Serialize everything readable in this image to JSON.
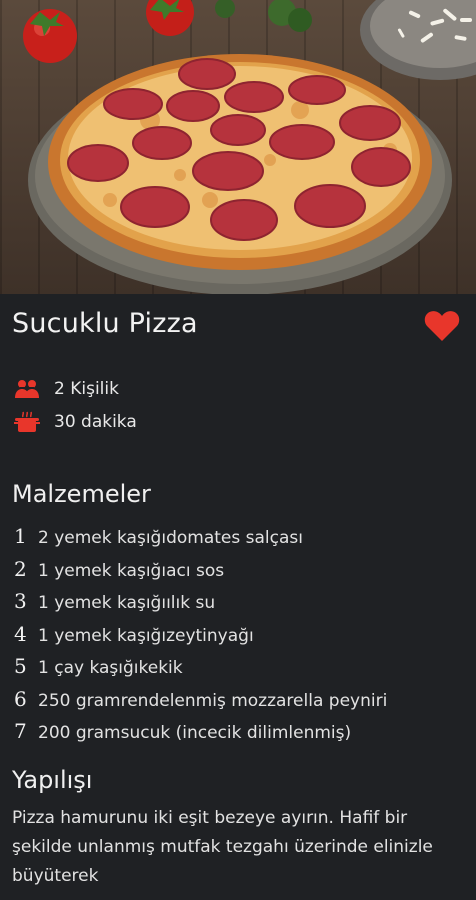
{
  "recipe": {
    "title": "Sucuklu Pizza",
    "favorite_icon": "heart-icon",
    "accent_color": "#e8362b",
    "servings": "2 Kişilik",
    "duration": "30 dakika"
  },
  "ingredients": {
    "title": "Malzemeler",
    "items": [
      {
        "num": "1",
        "text": "2 yemek kaşığıdomates salçası"
      },
      {
        "num": "2",
        "text": "1 yemek kaşığıacı sos"
      },
      {
        "num": "3",
        "text": "1 yemek kaşığıılık su"
      },
      {
        "num": "4",
        "text": "1 yemek kaşığızeytinyağı"
      },
      {
        "num": "5",
        "text": "1 çay kaşığıkekik"
      },
      {
        "num": "6",
        "text": "250 gramrendelenmiş mozzarella peyniri"
      },
      {
        "num": "7",
        "text": "200 gramsucuk (incecik dilimlenmiş)"
      }
    ]
  },
  "preparation": {
    "title": "Yapılışı",
    "text": "Pizza hamurunu iki eşit bezeye ayırın. Hafif bir şekilde unlanmış mutfak tezgahı üzerinde elinizle büyüterek"
  }
}
